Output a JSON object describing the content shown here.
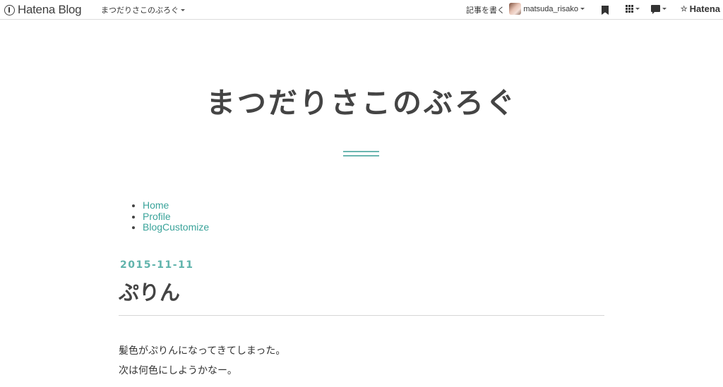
{
  "header": {
    "logo_text": "Hatena Blog",
    "blog_switcher_label": "まつだりさこのぶろぐ",
    "write_label": "記事を書く",
    "username": "matsuda_risako",
    "brand_label": "Hatena"
  },
  "blog": {
    "title": "まつだりさこのぶろぐ",
    "accent_color": "#6bb6b0"
  },
  "nav": {
    "items": [
      {
        "label": "Home"
      },
      {
        "label": "Profile"
      },
      {
        "label": "BlogCustomize"
      }
    ]
  },
  "entry": {
    "date": "2015-11-11",
    "title": "ぷりん",
    "body": [
      "髪色がぷりんになってきてしまった。",
      "次は何色にしようかなー。"
    ]
  }
}
